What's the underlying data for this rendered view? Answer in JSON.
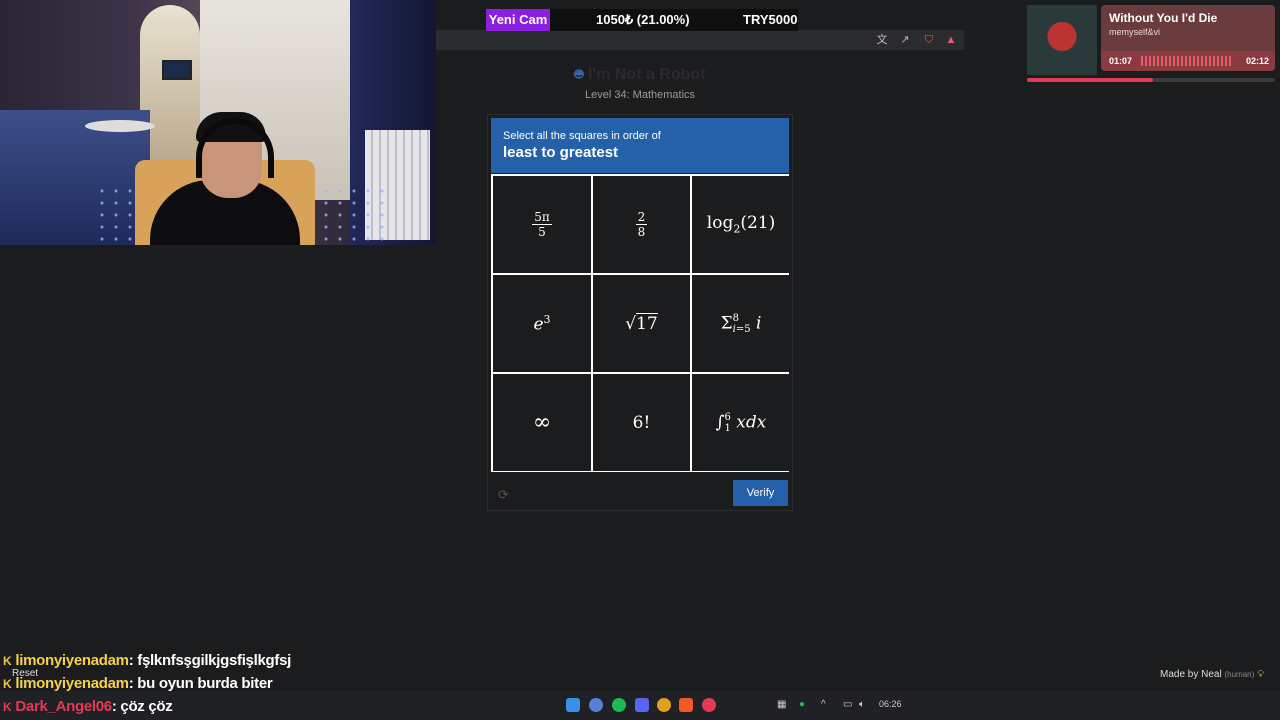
{
  "stats": {
    "cam_label": "Yeni Cam",
    "goal": "1050₺ (21.00%)",
    "target": "TRY5000"
  },
  "music": {
    "title": "Without You I'd Die",
    "artist": "memyself&vi",
    "current": "01:07",
    "total": "02:12",
    "progress_fraction": 0.51
  },
  "captcha": {
    "title": "I'm Not a Robot",
    "subtitle": "Level 34: Mathematics",
    "prompt": "Select all the squares in order of",
    "prompt_bold": "least to greatest",
    "verify_label": "Verify",
    "cells": [
      "5π/5",
      "2/8",
      "log₂(21)",
      "e³",
      "√17",
      "Σ₍ᵢ₌₅₎⁸ i",
      "∞",
      "6!",
      "∫₁⁶ x dx"
    ]
  },
  "chat": [
    {
      "user": "limonyiyenadam",
      "message": "fşlknfsşgilkjgsfişlkgfsj"
    },
    {
      "user": "limonyiyenadam",
      "message": "bu oyun burda biter"
    },
    {
      "user": "Dark_Angel06",
      "message": "çöz çöz"
    }
  ],
  "reset_label": "Reset",
  "made_by": {
    "text": "Made by Neal",
    "tag": "(human)"
  },
  "clock": "06:26"
}
